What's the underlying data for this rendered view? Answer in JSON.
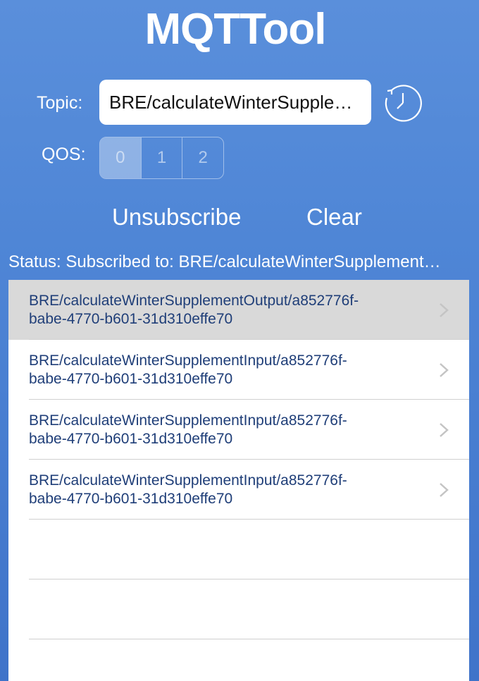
{
  "app": {
    "title": "MQTTool"
  },
  "topic": {
    "label": "Topic:",
    "value": "BRE/calculateWinterSupple…"
  },
  "qos": {
    "label": "QOS:",
    "options": [
      "0",
      "1",
      "2"
    ],
    "selected": "0"
  },
  "actions": {
    "unsubscribe": "Unsubscribe",
    "clear": "Clear"
  },
  "status": {
    "text": "Status: Subscribed to: BRE/calculateWinterSupplement…"
  },
  "messages": [
    {
      "line1": "BRE/calculateWinterSupplementOutput/a852776f-",
      "line2": "babe-4770-b601-31d310effe70",
      "selected": true
    },
    {
      "line1": "BRE/calculateWinterSupplementInput/a852776f-",
      "line2": "babe-4770-b601-31d310effe70",
      "selected": false
    },
    {
      "line1": "BRE/calculateWinterSupplementInput/a852776f-",
      "line2": "babe-4770-b601-31d310effe70",
      "selected": false
    },
    {
      "line1": "BRE/calculateWinterSupplementInput/a852776f-",
      "line2": "babe-4770-b601-31d310effe70",
      "selected": false
    }
  ],
  "colors": {
    "background": "#4f86d6",
    "link_text": "#1f3e78",
    "selected_row": "#d9d9d9"
  },
  "icons": {
    "history": "history-clock-icon",
    "disclosure": "chevron-right-icon"
  }
}
